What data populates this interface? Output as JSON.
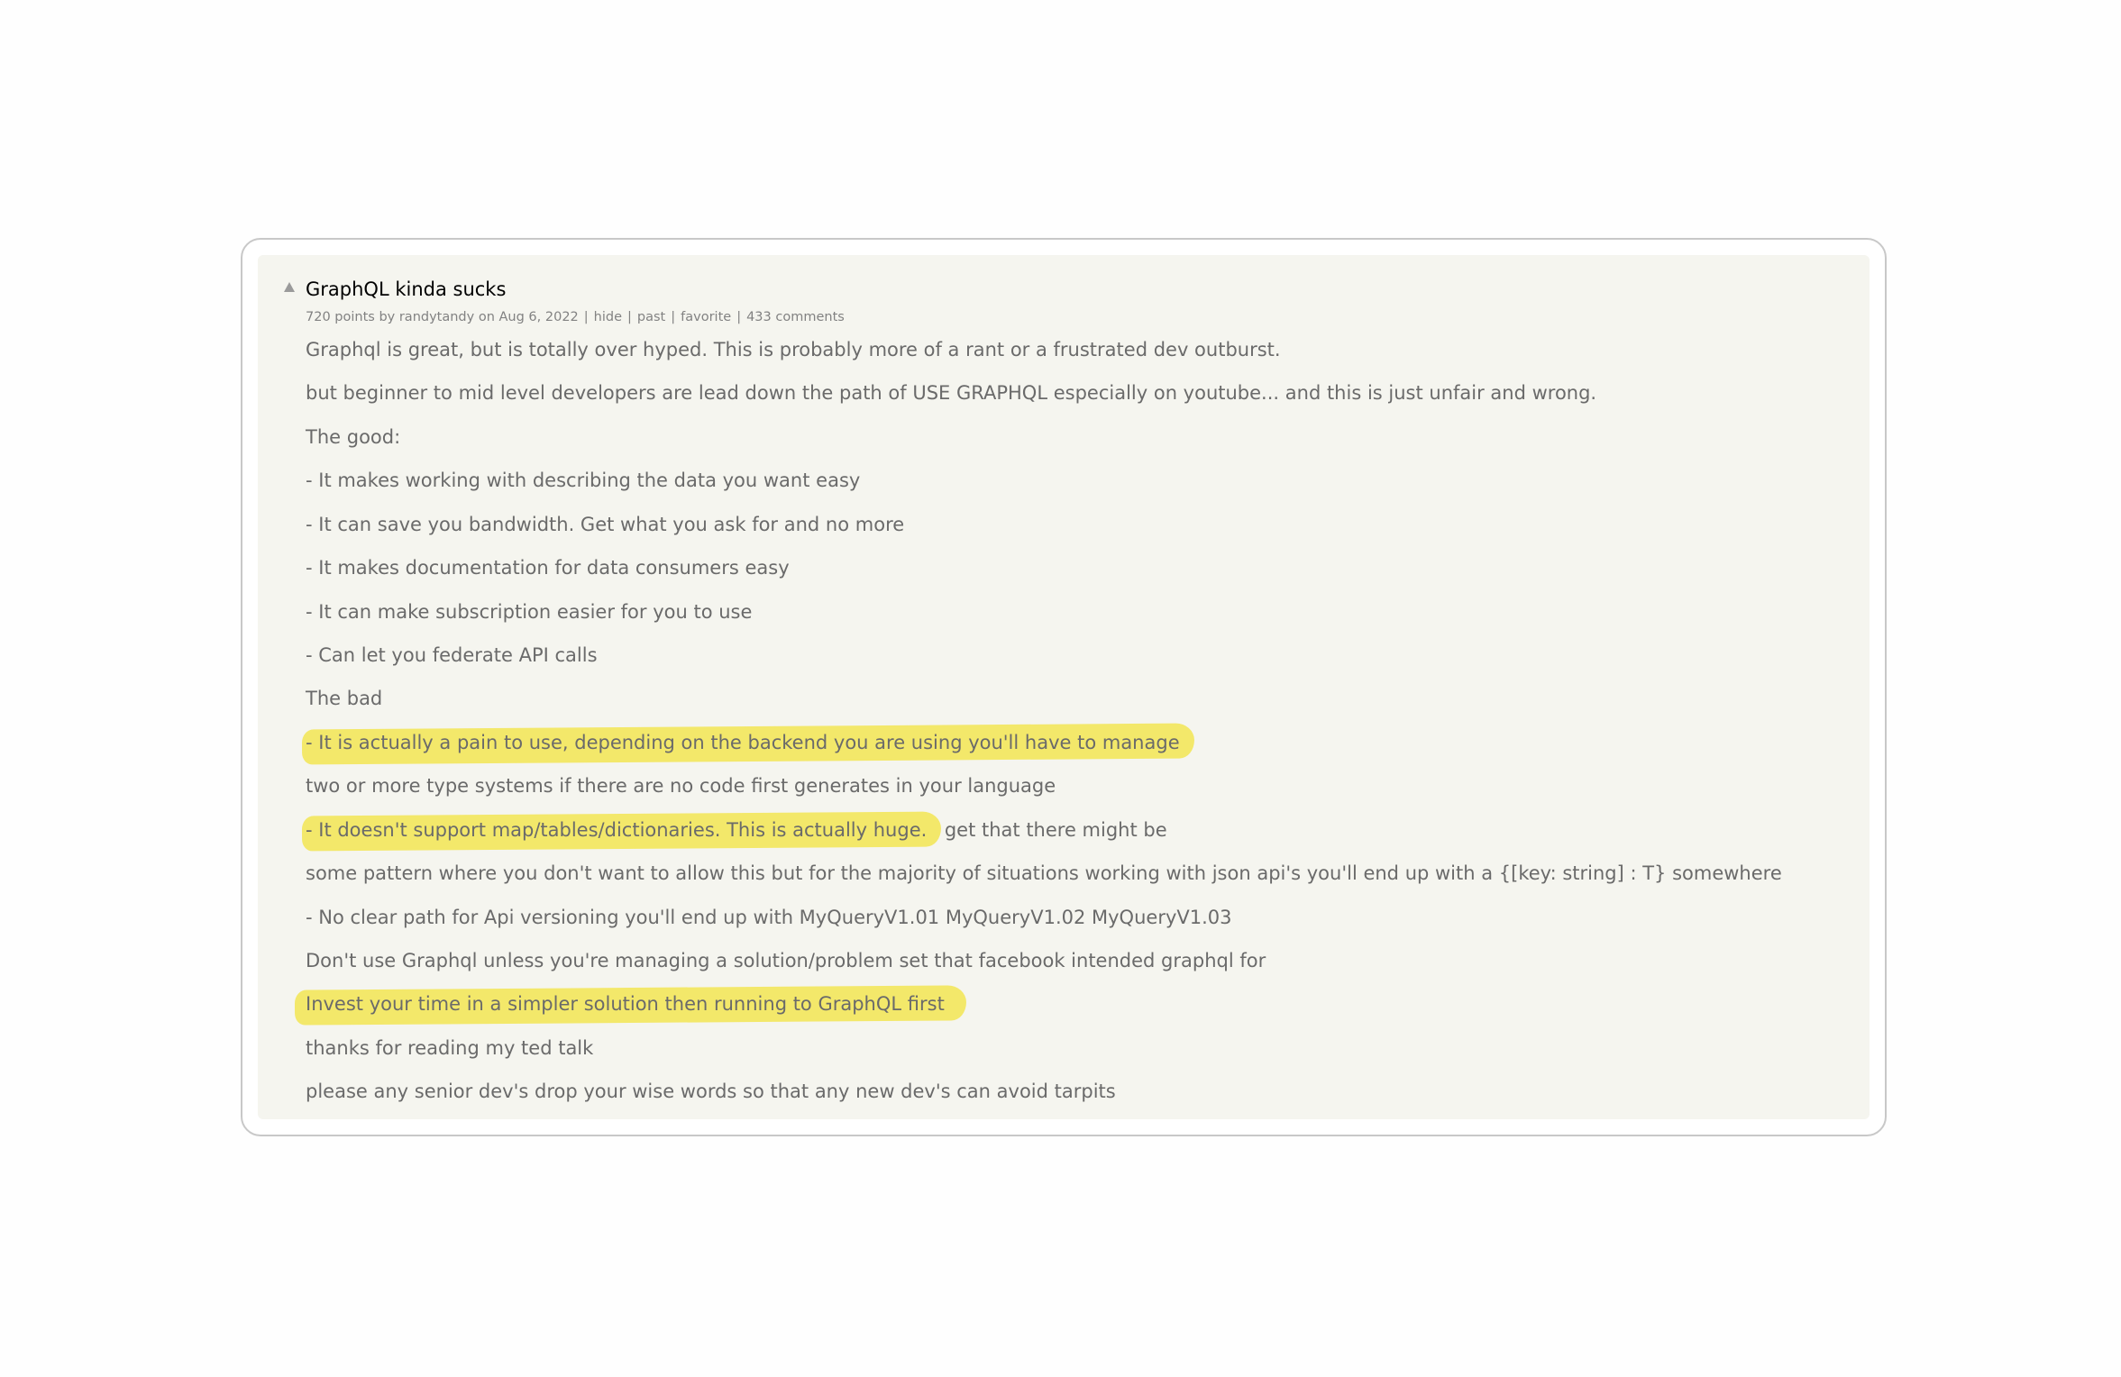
{
  "post": {
    "title": "GraphQL kinda sucks",
    "points": "720 points",
    "by_prefix": "by",
    "author": "randytandy",
    "date": "on Aug 6, 2022",
    "links": {
      "hide": "hide",
      "past": "past",
      "favorite": "favorite",
      "comments": "433 comments"
    },
    "separator": "|",
    "lines": [
      "Graphql is great, but is totally over hyped. This is probably more of a rant or a frustrated dev outburst.",
      "but beginner to mid level developers are lead down the path of USE GRAPHQL especially on youtube... and this is just unfair and wrong.",
      "The good:",
      "- It makes working with describing the data you want easy",
      "- It can save you bandwidth. Get what you ask for and no more",
      "- It makes documentation for data consumers easy",
      "- It can make subscription easier for you to use",
      "- Can let you federate API calls",
      "The bad",
      "- It is actually a pain to use, depending on the backend you are using you'll have to manage",
      "two or more type systems if there are no code first generates in your language",
      "- It doesn't support map/tables/dictionaries. This is actually huge.",
      " I get that there might be",
      "some pattern where you don't want to allow this but for the majority of situations working with json api's you'll end up with a {[key: string] : T} somewhere",
      "- No clear path for Api versioning you'll end up with MyQueryV1.01 MyQueryV1.02 MyQueryV1.03",
      "Don't use Graphql unless you're managing a solution/problem set that facebook intended graphql for",
      "Invest your time in a simpler solution then running to GraphQL first",
      "thanks for reading my ted talk",
      "please any senior dev's drop your wise words so that any new dev's can avoid tarpits"
    ]
  },
  "colors": {
    "highlight": "#f3e86a",
    "panel_bg": "#f5f5ef",
    "text": "#6a6a6a",
    "subtext": "#828282"
  },
  "icons": {
    "vote": "upvote-arrow-icon"
  }
}
